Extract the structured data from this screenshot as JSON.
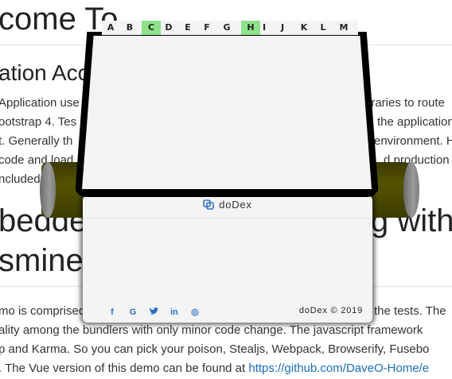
{
  "background": {
    "title": "come To",
    "subtitle": "ation Acc",
    "paragraph1": [
      "Application use",
      "ootstrap 4. Tes",
      "t. Generally th",
      "code and load",
      "ncluded"
    ],
    "paragraph1_right": [
      "braries to route",
      "the application",
      "environment. H",
      "d production"
    ],
    "heading2_line1_left": "bedde",
    "heading2_line1_right": "g with",
    "heading2_line2": "smine",
    "paragraph2": [
      "mo is comprised",
      "ality among the bundlers with only minor code change. The javascript framework",
      "p and Karma. So you can pick your poison, Stealjs, Webpack, Browserify, Fusebo",
      ". The Vue version of this demo can be found at "
    ],
    "paragraph2_right": "the tests. The",
    "link": "https://github.com/DaveO-Home/e"
  },
  "letter_bar": {
    "letters": [
      "A",
      "B",
      "C",
      "D",
      "E",
      "F",
      "G",
      "H",
      "I",
      "J",
      "K",
      "L",
      "M"
    ],
    "highlighted": [
      "C",
      "H"
    ],
    "highlight_color": "#8ee28a"
  },
  "panel": {
    "brand": "doDex",
    "copyright": "doDex © 2019",
    "socials": [
      {
        "icon": "facebook-icon",
        "glyph": "f"
      },
      {
        "icon": "google-icon",
        "glyph": "G"
      },
      {
        "icon": "twitter-icon",
        "glyph": "✔"
      },
      {
        "icon": "linkedin-icon",
        "glyph": "in"
      },
      {
        "icon": "dribbble-icon",
        "glyph": "◎"
      }
    ]
  },
  "colors": {
    "roller": "#4a4800",
    "link": "#1a6ebd",
    "social": "#2b6fc7"
  }
}
